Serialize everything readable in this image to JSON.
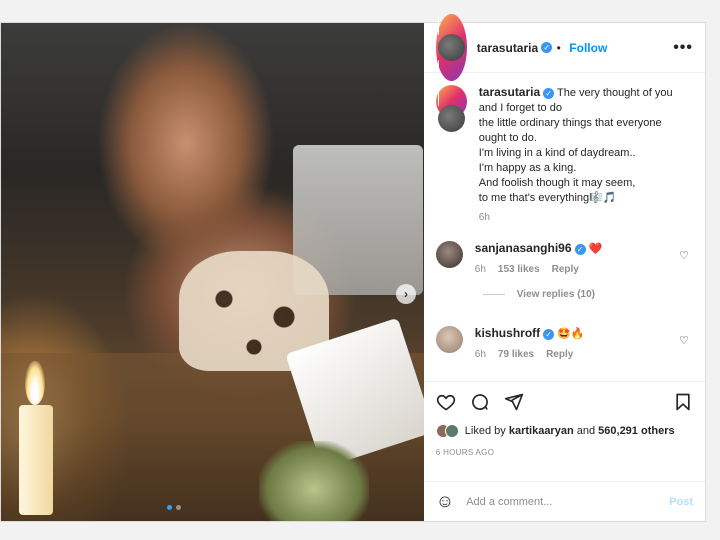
{
  "post": {
    "username": "tarasutaria",
    "follow_label": "Follow",
    "more_label": "•••",
    "verified_mark": "✓"
  },
  "caption": {
    "username": "tarasutaria",
    "text": "The very thought of you\nand I forget to do\nthe little ordinary things that everyone\nought to do.\nI'm living in a kind of daydream..\nI'm happy as a king.\nAnd foolish though it may seem,\nto me that's everything🎼🎵",
    "age": "6h"
  },
  "comments": [
    {
      "username": "sanjanasanghi96",
      "text": "❤️",
      "age": "6h",
      "likes": "153 likes",
      "reply_label": "Reply"
    },
    {
      "username": "kishushroff",
      "text": "🤩🔥",
      "age": "6h",
      "likes": "79 likes",
      "reply_label": "Reply"
    }
  ],
  "view_replies": "View replies (10)",
  "likes": {
    "prefix": "Liked by",
    "user": "kartikaaryan",
    "joiner": "and",
    "others": "560,291 others"
  },
  "timestamp": "6 HOURS AGO",
  "composer": {
    "placeholder": "Add a comment...",
    "post_label": "Post"
  },
  "carousel": {
    "next_label": "›",
    "active_index": 1,
    "total": 2
  },
  "colors": {
    "accent": "#0095f6",
    "verified": "#3897f0",
    "muted": "#8e8e8e"
  }
}
